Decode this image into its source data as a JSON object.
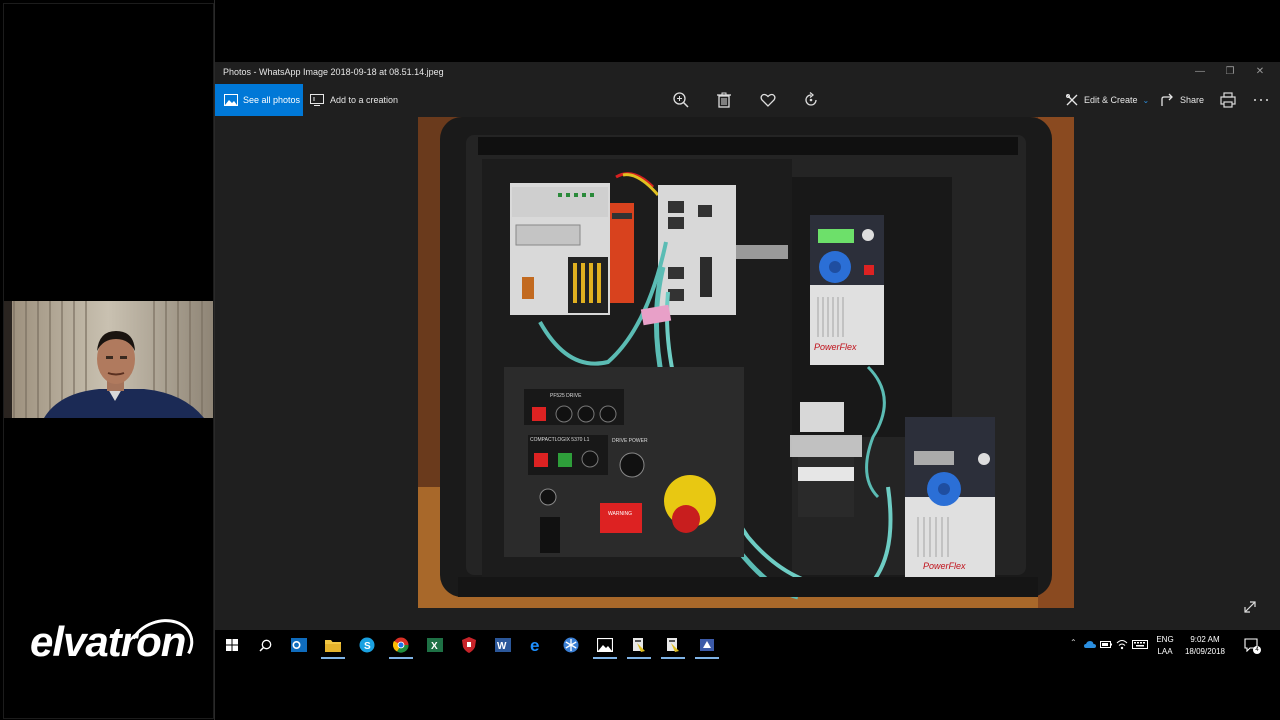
{
  "window": {
    "title": "Photos - WhatsApp Image 2018-09-18 at 08.51.14.jpeg"
  },
  "toolbar": {
    "see_all_label": "See all photos",
    "add_creation_label": "Add to a creation",
    "edit_create_label": "Edit & Create",
    "share_label": "Share"
  },
  "photo": {
    "drive_brand_1": "PowerFlex",
    "drive_brand_2": "PowerFlex",
    "warning_label": "WARNING",
    "panel_label_1": "PF525 DRIVE",
    "panel_label_2": "COMPACTLOGIX 5370 L1",
    "panel_label_3": "DRIVE POWER"
  },
  "brand": {
    "logo_text": "elvatron"
  },
  "tray": {
    "lang_top": "ENG",
    "lang_bottom": "LAA",
    "time": "9:02 AM",
    "date": "18/09/2018",
    "notif_count": "4"
  },
  "colors": {
    "accent": "#0078d7",
    "titlebar_bg": "#1f1f1f",
    "taskbar_bg": "#000000"
  }
}
